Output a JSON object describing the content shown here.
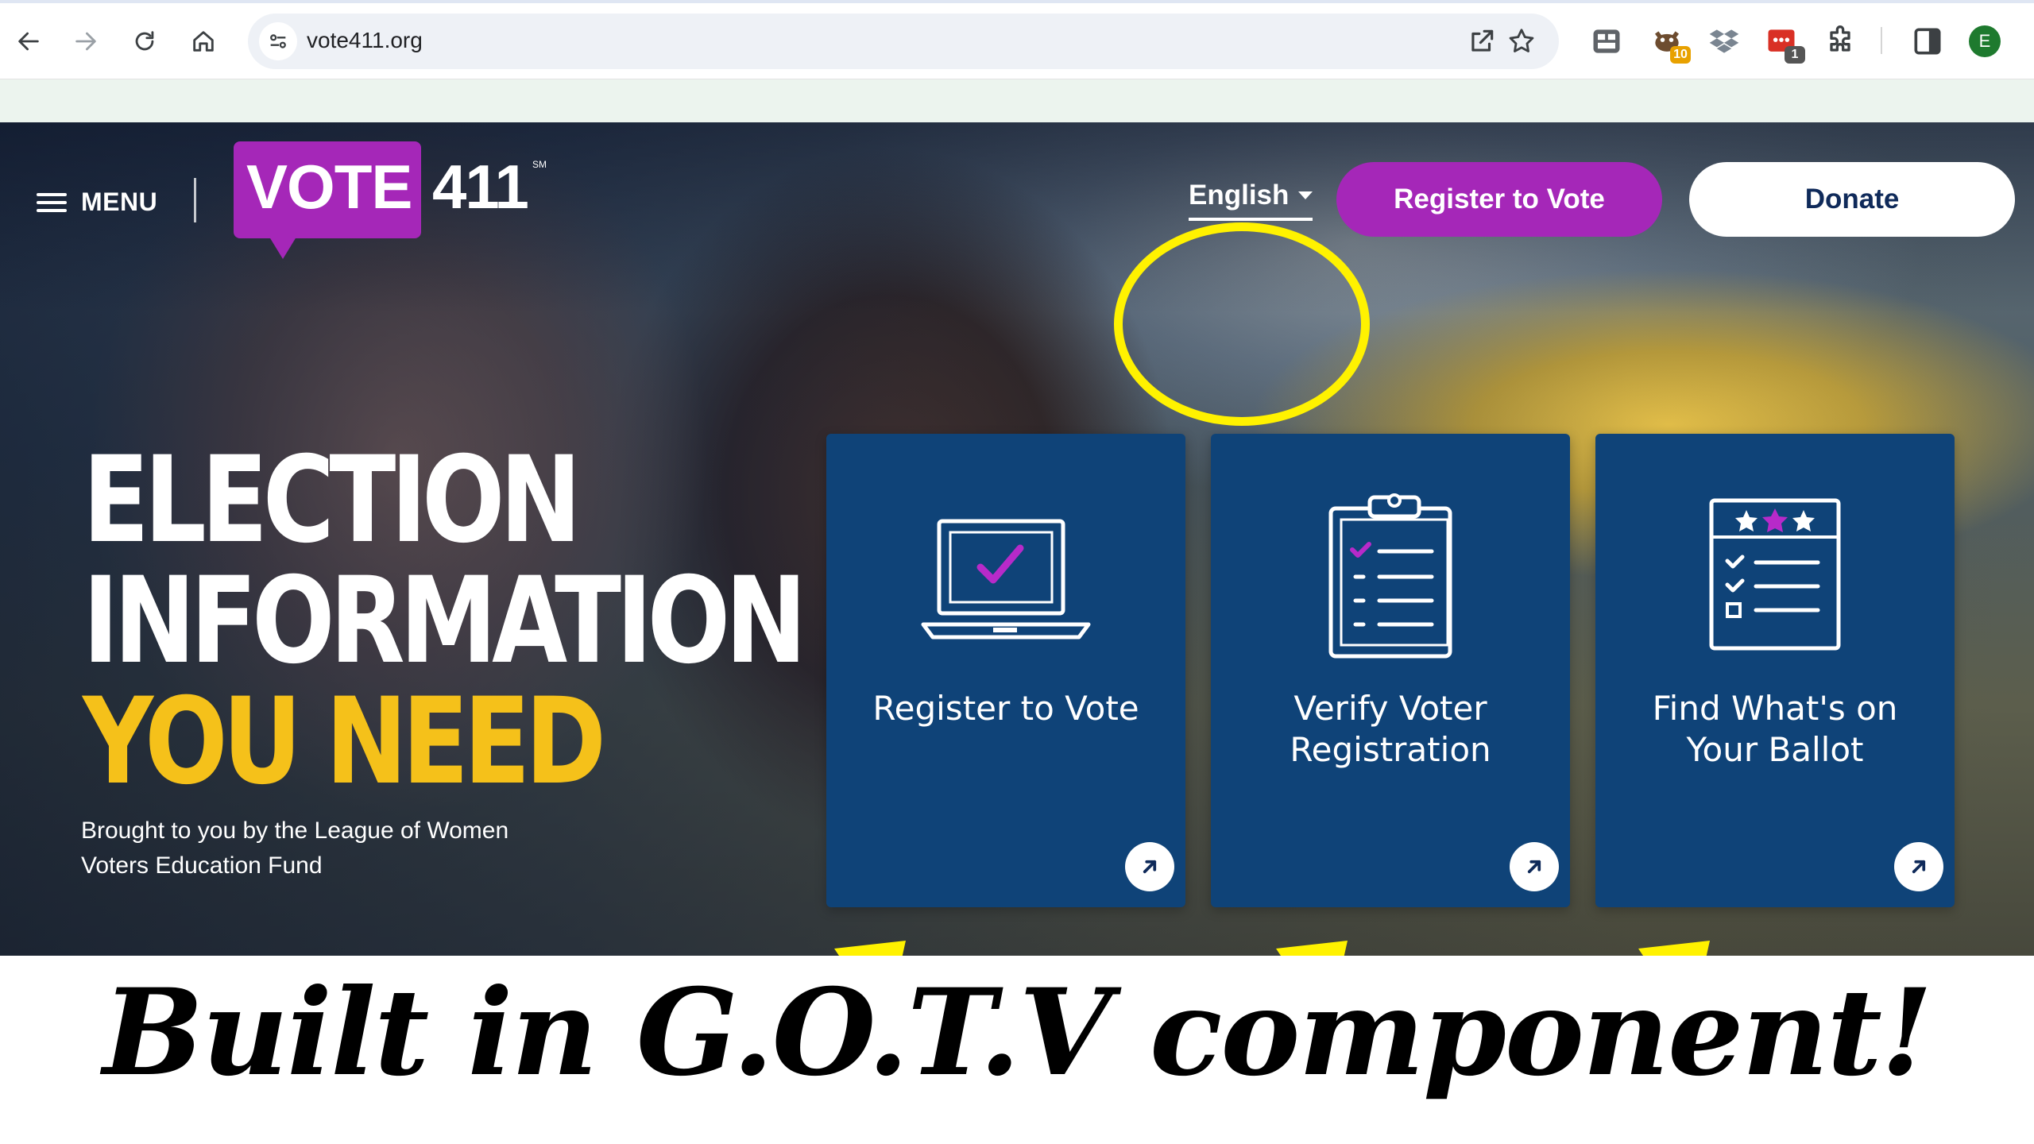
{
  "browser": {
    "url": "vote411.org",
    "extensions": [
      {
        "icon": "extension-grid-icon",
        "badge": ""
      },
      {
        "icon": "extension-dog-icon",
        "badge": "10",
        "badge_color": "#e8a100"
      },
      {
        "icon": "dropbox-icon",
        "badge": ""
      },
      {
        "icon": "extension-red-icon",
        "badge": "1",
        "badge_color": "#555555"
      },
      {
        "icon": "puzzle-icon",
        "badge": ""
      }
    ],
    "profile_initial": "E"
  },
  "site": {
    "menu_label": "MENU",
    "logo_vote": "VOTE",
    "logo_number": "411",
    "logo_mark": "SM",
    "language": "English",
    "register_button": "Register to Vote",
    "donate_button": "Donate",
    "headline": [
      "ELECTION",
      "INFORMATION",
      "YOU NEED"
    ],
    "byline": "Brought to you by the League of Women Voters Education Fund",
    "cards": [
      {
        "title": "Register to Vote",
        "icon": "laptop-check-icon"
      },
      {
        "title": "Verify Voter\nRegistration",
        "icon": "clipboard-checklist-icon"
      },
      {
        "title": "Find What's on\nYour Ballot",
        "icon": "ballot-stars-icon"
      }
    ]
  },
  "annotation": {
    "caption": "Built in G.O.T.V component!",
    "highlight_color": "#fff200"
  },
  "colors": {
    "brand_purple": "#a527b8",
    "card_blue": "#0f4378",
    "headline_yellow": "#f5c11a"
  }
}
